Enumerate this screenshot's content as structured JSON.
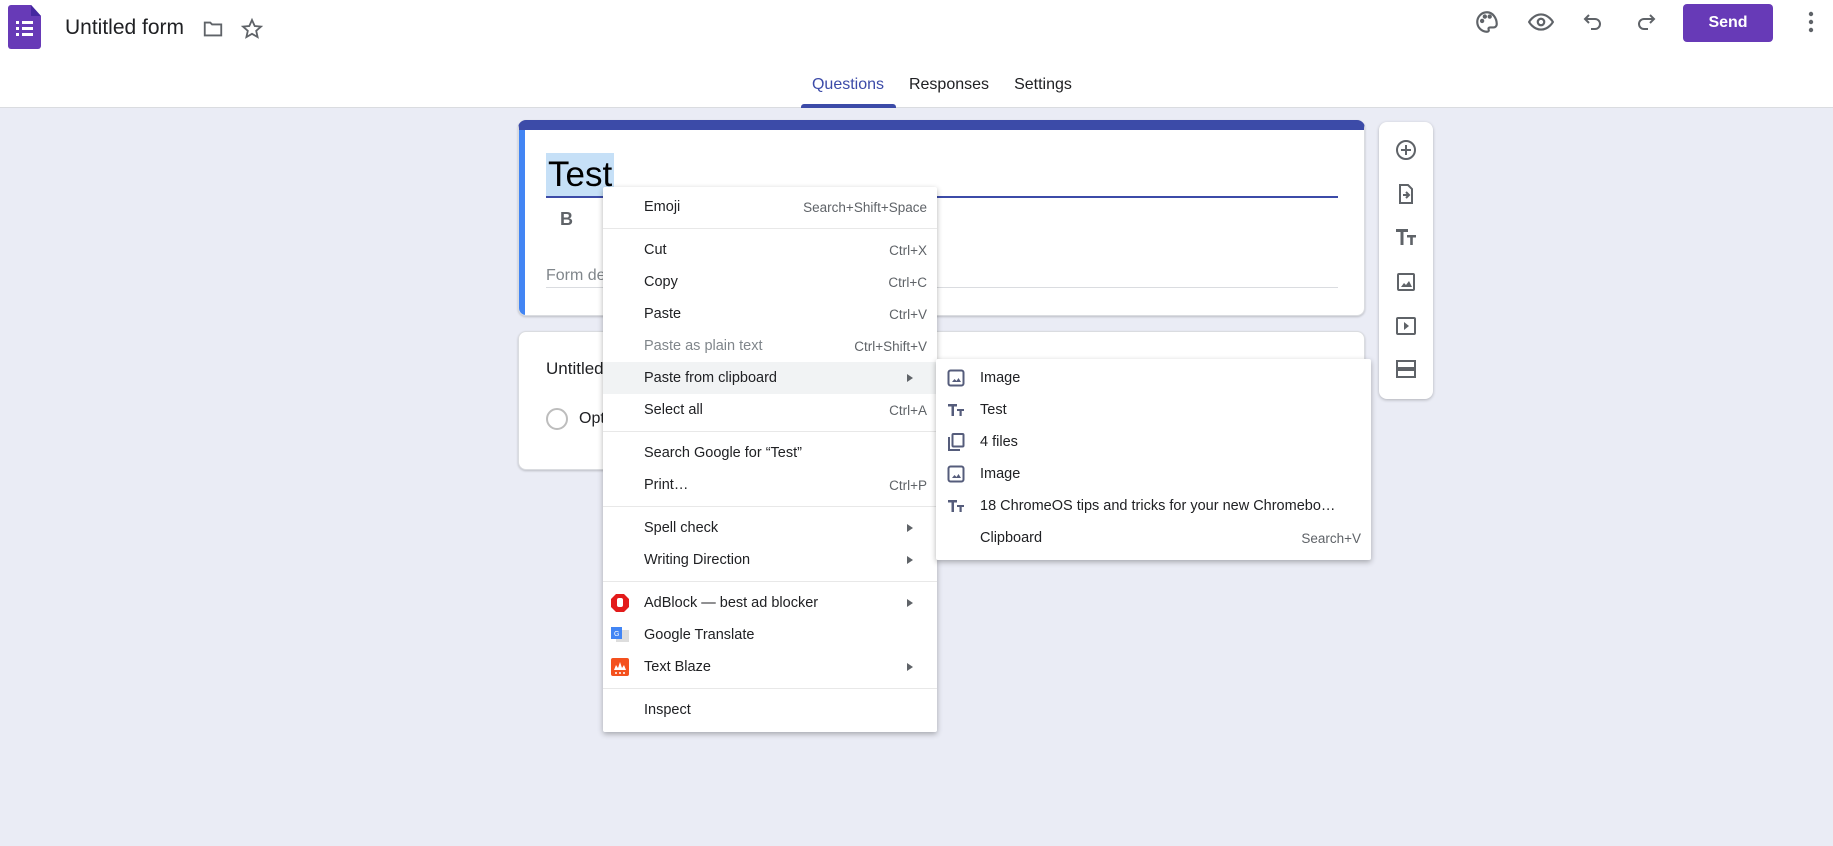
{
  "header": {
    "title": "Untitled form",
    "send_label": "Send",
    "icons": [
      "forms-logo-icon",
      "folder-icon",
      "star-icon",
      "palette-icon",
      "eye-icon",
      "undo-icon",
      "redo-icon",
      "more-vert-icon"
    ]
  },
  "tabs": [
    {
      "label": "Questions",
      "active": true
    },
    {
      "label": "Responses"
    },
    {
      "label": "Settings"
    }
  ],
  "form": {
    "title": "Test",
    "bold_label": "B",
    "description_placeholder": "Form de",
    "question_title": "Untitled",
    "option_label": "Opt"
  },
  "colors": {
    "accent": "#673ab7",
    "header_bar": "#3c4ba8",
    "selection": "#c6e0f7",
    "background": "#eaecf5"
  },
  "context_menu": {
    "items": [
      {
        "label": "Emoji",
        "shortcut": "Search+Shift+Space"
      },
      {
        "label": "Cut",
        "shortcut": "Ctrl+X"
      },
      {
        "label": "Copy",
        "shortcut": "Ctrl+C"
      },
      {
        "label": "Paste",
        "shortcut": "Ctrl+V"
      },
      {
        "label": "Paste as plain text",
        "shortcut": "Ctrl+Shift+V",
        "disabled": true
      },
      {
        "label": "Paste from clipboard",
        "submenu": true,
        "highlighted": true
      },
      {
        "label": "Select all",
        "shortcut": "Ctrl+A"
      },
      {
        "label": "Search Google for “Test”"
      },
      {
        "label": "Print…",
        "shortcut": "Ctrl+P"
      },
      {
        "label": "Spell check",
        "submenu": true
      },
      {
        "label": "Writing Direction",
        "submenu": true
      },
      {
        "label": "AdBlock — best ad blocker",
        "submenu": true,
        "icon": "adblock-icon"
      },
      {
        "label": "Google Translate",
        "icon": "google-translate-icon"
      },
      {
        "label": "Text Blaze",
        "submenu": true,
        "icon": "text-blaze-icon"
      },
      {
        "label": "Inspect"
      }
    ]
  },
  "clipboard_submenu": {
    "items": [
      {
        "label": "Image",
        "icon": "image-icon"
      },
      {
        "label": "Test",
        "icon": "text-icon"
      },
      {
        "label": "4 files",
        "icon": "files-icon"
      },
      {
        "label": "Image",
        "icon": "image-icon"
      },
      {
        "label": "18 ChromeOS tips and tricks for your new Chromebo…",
        "icon": "text-icon"
      },
      {
        "label": "Clipboard",
        "shortcut": "Search+V"
      }
    ]
  }
}
